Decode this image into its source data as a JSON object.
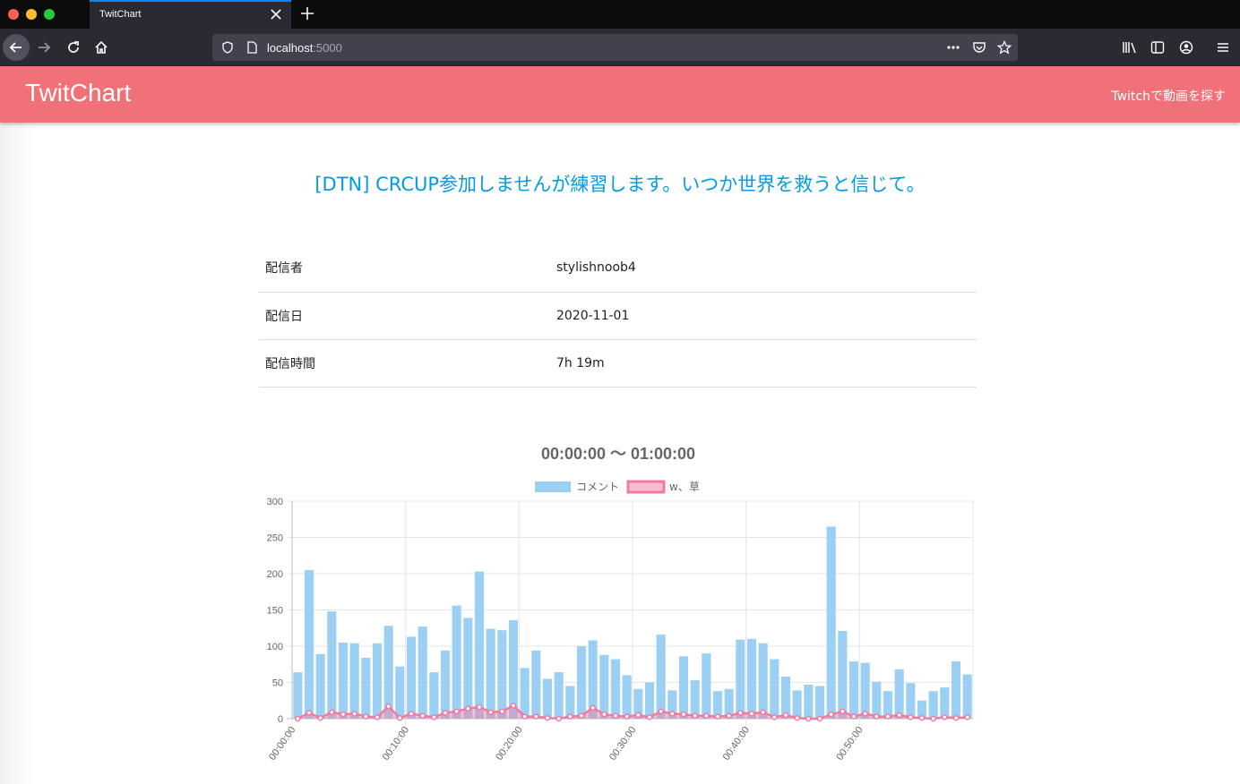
{
  "browser": {
    "tab_title": "TwitChart",
    "url_host": "localhost",
    "url_port": ":5000"
  },
  "header": {
    "brand": "TwitChart",
    "nav_link": "Twitchで動画を探す",
    "color": "#f07177"
  },
  "video": {
    "title": "[DTN] CRCUP参加しませんが練習します。いつか世界を救うと信じて。",
    "info": [
      {
        "label": "配信者",
        "value": "stylishnoob4",
        "is_link": true
      },
      {
        "label": "配信日",
        "value": "2020-11-01",
        "is_link": false
      },
      {
        "label": "配信時間",
        "value": "7h 19m",
        "is_link": false
      }
    ]
  },
  "chart_data": {
    "type": "bar",
    "title": "00:00:00 〜 01:00:00",
    "legend_position": "top",
    "grid": true,
    "ylim": [
      0,
      300
    ],
    "y_ticks": [
      0,
      50,
      100,
      150,
      200,
      250,
      300
    ],
    "x_tick_labels": [
      "00:00:00",
      "00:10:00",
      "00:20:00",
      "00:30:00",
      "00:40:00",
      "00:50:00"
    ],
    "x_tick_every": 10,
    "categories_count": 60,
    "series": [
      {
        "name": "コメント",
        "type": "bar",
        "color": "#9ccff4",
        "values": [
          64,
          205,
          89,
          148,
          105,
          104,
          84,
          104,
          128,
          72,
          113,
          127,
          64,
          94,
          156,
          139,
          203,
          124,
          122,
          136,
          70,
          94,
          55,
          64,
          45,
          100,
          108,
          88,
          82,
          60,
          41,
          50,
          116,
          39,
          86,
          53,
          90,
          38,
          41,
          109,
          110,
          104,
          82,
          58,
          39,
          47,
          45,
          265,
          121,
          79,
          77,
          51,
          38,
          68,
          49,
          25,
          38,
          43,
          79,
          61
        ]
      },
      {
        "name": "w、草",
        "type": "line",
        "color": "#f17aa0",
        "values": [
          0,
          8,
          1,
          9,
          6,
          7,
          3,
          2,
          17,
          1,
          7,
          4,
          2,
          8,
          10,
          14,
          16,
          9,
          10,
          18,
          3,
          3,
          1,
          0,
          3,
          4,
          15,
          6,
          4,
          3,
          5,
          2,
          10,
          7,
          6,
          4,
          4,
          3,
          4,
          8,
          7,
          9,
          2,
          5,
          1,
          0,
          0,
          6,
          10,
          3,
          7,
          3,
          3,
          5,
          2,
          1,
          0,
          2,
          1,
          2
        ]
      }
    ]
  }
}
